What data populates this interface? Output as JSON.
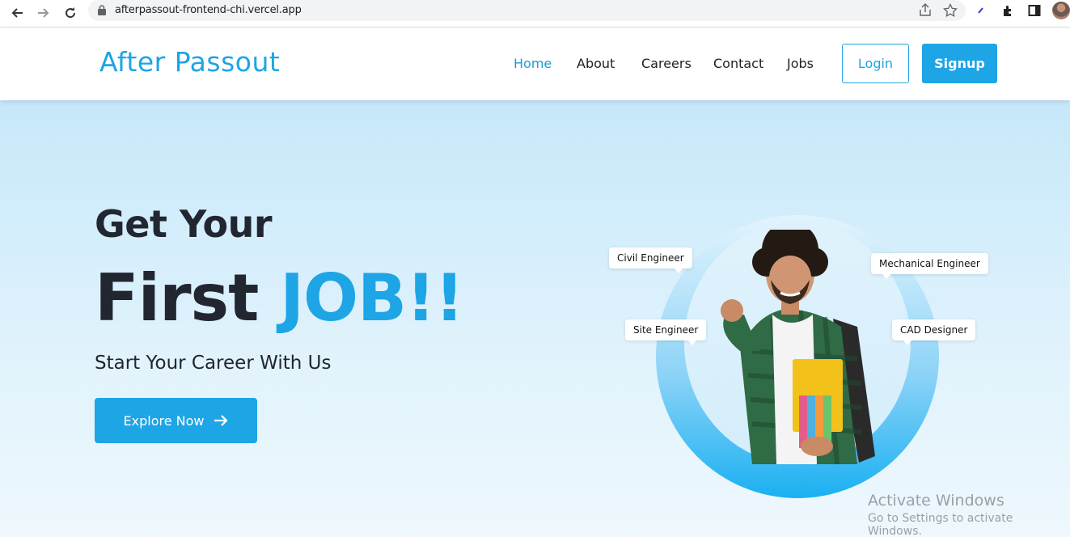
{
  "browser": {
    "url": "afterpassout-frontend-chi.vercel.app"
  },
  "header": {
    "logo": "After Passout",
    "nav": [
      {
        "label": "Home",
        "active": true
      },
      {
        "label": "About",
        "active": false
      },
      {
        "label": "Careers",
        "active": false
      },
      {
        "label": "Contact",
        "active": false
      },
      {
        "label": "Jobs",
        "active": false
      }
    ],
    "login_label": "Login",
    "signup_label": "Signup"
  },
  "hero": {
    "line1": "Get Your",
    "line2_plain": "First ",
    "line2_accent": "JOB!!",
    "subtitle": "Start Your Career With Us",
    "cta_label": "Explore Now",
    "tags": [
      "Civil Engineer",
      "Mechanical Engineer",
      "Site Engineer",
      "CAD Designer"
    ]
  },
  "watermark": {
    "title": "Activate Windows",
    "subtitle": "Go to Settings to activate Windows."
  },
  "colors": {
    "accent": "#1da5e6",
    "text_dark": "#222630"
  }
}
